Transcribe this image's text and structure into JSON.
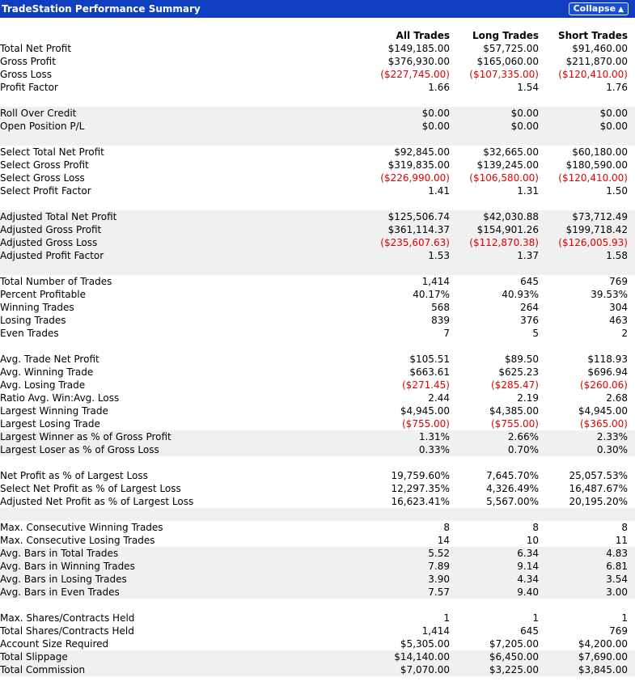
{
  "header": {
    "title": "TradeStation Performance Summary",
    "collapse_label": "Collapse",
    "collapse_icon": "double-chevron-up-icon"
  },
  "columns": [
    "All Trades",
    "Long Trades",
    "Short Trades"
  ],
  "colors": {
    "title_bar": "#0f3ec0",
    "negative": "#e00000",
    "band": "#f0f0f0"
  },
  "rows": [
    {
      "label": "Total Net Profit",
      "v": [
        "$149,185.00",
        "$57,725.00",
        "$91,460.00"
      ],
      "shade": false
    },
    {
      "label": "Gross Profit",
      "v": [
        "$376,930.00",
        "$165,060.00",
        "$211,870.00"
      ],
      "shade": false
    },
    {
      "label": "Gross Loss",
      "v": [
        "($227,745.00)",
        "($107,335.00)",
        "($120,410.00)"
      ],
      "shade": false
    },
    {
      "label": "Profit Factor",
      "v": [
        "1.66",
        "1.54",
        "1.76"
      ],
      "shade": false
    },
    {
      "gap": true,
      "shade": false
    },
    {
      "label": "Roll Over Credit",
      "v": [
        "$0.00",
        "$0.00",
        "$0.00"
      ],
      "shade": true
    },
    {
      "label": "Open Position P/L",
      "v": [
        "$0.00",
        "$0.00",
        "$0.00"
      ],
      "shade": true
    },
    {
      "gap": true,
      "shade": true
    },
    {
      "label": "Select Total Net Profit",
      "v": [
        "$92,845.00",
        "$32,665.00",
        "$60,180.00"
      ],
      "shade": false
    },
    {
      "label": "Select Gross Profit",
      "v": [
        "$319,835.00",
        "$139,245.00",
        "$180,590.00"
      ],
      "shade": false
    },
    {
      "label": "Select Gross Loss",
      "v": [
        "($226,990.00)",
        "($106,580.00)",
        "($120,410.00)"
      ],
      "shade": false
    },
    {
      "label": "Select Profit Factor",
      "v": [
        "1.41",
        "1.31",
        "1.50"
      ],
      "shade": false
    },
    {
      "gap": true,
      "shade": false
    },
    {
      "label": "Adjusted Total Net Profit",
      "v": [
        "$125,506.74",
        "$42,030.88",
        "$73,712.49"
      ],
      "shade": true
    },
    {
      "label": "Adjusted Gross Profit",
      "v": [
        "$361,114.37",
        "$154,901.26",
        "$199,718.42"
      ],
      "shade": true
    },
    {
      "label": "Adjusted Gross Loss",
      "v": [
        "($235,607.63)",
        "($112,870.38)",
        "($126,005.93)"
      ],
      "shade": true
    },
    {
      "label": "Adjusted Profit Factor",
      "v": [
        "1.53",
        "1.37",
        "1.58"
      ],
      "shade": true
    },
    {
      "gap": true,
      "shade": true
    },
    {
      "label": "Total Number of Trades",
      "v": [
        "1,414",
        "645",
        "769"
      ],
      "shade": false
    },
    {
      "label": "Percent Profitable",
      "v": [
        "40.17%",
        "40.93%",
        "39.53%"
      ],
      "shade": false
    },
    {
      "label": "Winning Trades",
      "v": [
        "568",
        "264",
        "304"
      ],
      "shade": false
    },
    {
      "label": "Losing Trades",
      "v": [
        "839",
        "376",
        "463"
      ],
      "shade": false
    },
    {
      "label": "Even Trades",
      "v": [
        "7",
        "5",
        "2"
      ],
      "shade": false
    },
    {
      "gap": true,
      "shade": false
    },
    {
      "label": "Avg. Trade Net Profit",
      "v": [
        "$105.51",
        "$89.50",
        "$118.93"
      ],
      "shade": false
    },
    {
      "label": "Avg. Winning Trade",
      "v": [
        "$663.61",
        "$625.23",
        "$696.94"
      ],
      "shade": false
    },
    {
      "label": "Avg. Losing Trade",
      "v": [
        "($271.45)",
        "($285.47)",
        "($260.06)"
      ],
      "shade": false
    },
    {
      "label": "Ratio Avg. Win:Avg. Loss",
      "v": [
        "2.44",
        "2.19",
        "2.68"
      ],
      "shade": false
    },
    {
      "label": "Largest Winning Trade",
      "v": [
        "$4,945.00",
        "$4,385.00",
        "$4,945.00"
      ],
      "shade": false
    },
    {
      "label": "Largest Losing Trade",
      "v": [
        "($755.00)",
        "($755.00)",
        "($365.00)"
      ],
      "shade": false
    },
    {
      "label": "Largest Winner as % of Gross Profit",
      "v": [
        "1.31%",
        "2.66%",
        "2.33%"
      ],
      "shade": true
    },
    {
      "label": "Largest Loser as % of Gross Loss",
      "v": [
        "0.33%",
        "0.70%",
        "0.30%"
      ],
      "shade": true
    },
    {
      "gap": true,
      "shade": false
    },
    {
      "label": "Net Profit as % of Largest Loss",
      "v": [
        "19,759.60%",
        "7,645.70%",
        "25,057.53%"
      ],
      "shade": false
    },
    {
      "label": "Select Net Profit as % of Largest Loss",
      "v": [
        "12,297.35%",
        "4,326.49%",
        "16,487.67%"
      ],
      "shade": false
    },
    {
      "label": "Adjusted Net Profit as % of Largest Loss",
      "v": [
        "16,623.41%",
        "5,567.00%",
        "20,195.20%"
      ],
      "shade": false
    },
    {
      "gap": true,
      "shade": true
    },
    {
      "label": "Max. Consecutive Winning Trades",
      "v": [
        "8",
        "8",
        "8"
      ],
      "shade": false
    },
    {
      "label": "Max. Consecutive Losing Trades",
      "v": [
        "14",
        "10",
        "11"
      ],
      "shade": false
    },
    {
      "label": "Avg. Bars in Total Trades",
      "v": [
        "5.52",
        "6.34",
        "4.83"
      ],
      "shade": true
    },
    {
      "label": "Avg. Bars in Winning Trades",
      "v": [
        "7.89",
        "9.14",
        "6.81"
      ],
      "shade": true
    },
    {
      "label": "Avg. Bars in Losing Trades",
      "v": [
        "3.90",
        "4.34",
        "3.54"
      ],
      "shade": true
    },
    {
      "label": "Avg. Bars in Even Trades",
      "v": [
        "7.57",
        "9.40",
        "3.00"
      ],
      "shade": true
    },
    {
      "gap": true,
      "shade": false
    },
    {
      "label": "Max. Shares/Contracts Held",
      "v": [
        "1",
        "1",
        "1"
      ],
      "shade": false
    },
    {
      "label": "Total Shares/Contracts Held",
      "v": [
        "1,414",
        "645",
        "769"
      ],
      "shade": false
    },
    {
      "label": "Account Size Required",
      "v": [
        "$5,305.00",
        "$7,205.00",
        "$4,200.00"
      ],
      "shade": false
    },
    {
      "label": "Total Slippage",
      "v": [
        "$14,140.00",
        "$6,450.00",
        "$7,690.00"
      ],
      "shade": true
    },
    {
      "label": "Total Commission",
      "v": [
        "$7,070.00",
        "$3,225.00",
        "$3,845.00"
      ],
      "shade": true
    }
  ]
}
